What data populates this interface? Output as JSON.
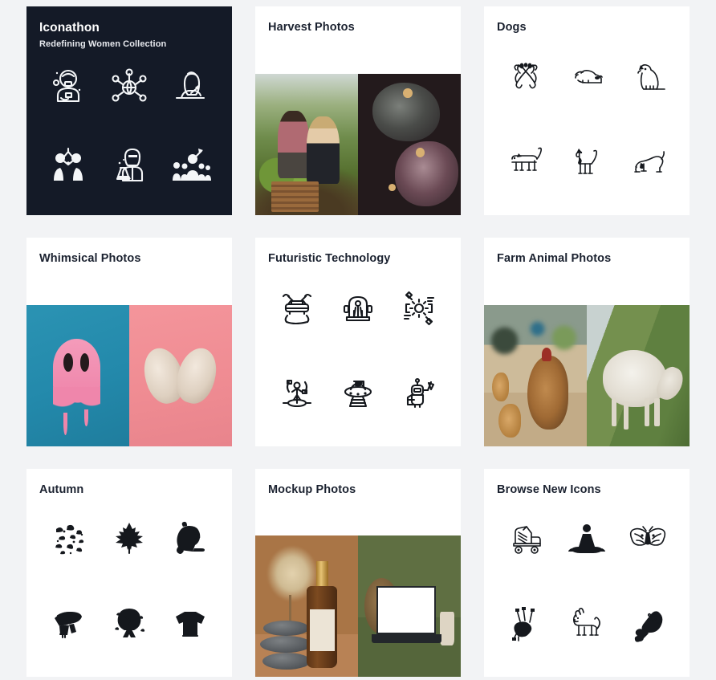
{
  "theme": {
    "page_background": "#f2f3f5",
    "card_background": "#ffffff",
    "dark_card_background": "#141a27",
    "title_color": "#1b2230",
    "icon_color": "#15181d",
    "whimsical_cyan": "#2389ab",
    "whimsical_pink": "#ef8b92",
    "mockup_tan": "#a97546",
    "mockup_green": "#5f6f42"
  },
  "cards": [
    {
      "id": "iconathon",
      "title": "Iconathon",
      "subtitle": "Redefining Women Collection",
      "kind": "icons",
      "dark": true,
      "icons": [
        "astronaut-woman-icon",
        "global-network-icon",
        "woman-writing-icon",
        "high-five-icon",
        "woman-scientist-flask-icon",
        "woman-leader-crowd-icon"
      ]
    },
    {
      "id": "harvest-photos",
      "title": "Harvest Photos",
      "subtitle": "",
      "kind": "photos",
      "dark": false,
      "photos": [
        "garden-harvest-family-photo",
        "dark-figs-closeup-photo"
      ]
    },
    {
      "id": "dogs",
      "title": "Dogs",
      "subtitle": "",
      "kind": "icons",
      "dark": false,
      "icons": [
        "dog-top-view-icon",
        "dog-lying-down-icon",
        "dog-sitting-icon",
        "dog-standing-icon",
        "dog-sitting-side-icon",
        "dog-play-bow-icon"
      ]
    },
    {
      "id": "whimsical-photos",
      "title": "Whimsical Photos",
      "subtitle": "",
      "kind": "photos",
      "dark": false,
      "photos": [
        "melting-pink-ghost-photo",
        "skull-heart-photo"
      ]
    },
    {
      "id": "futuristic-technology",
      "title": "Futuristic Technology",
      "subtitle": "",
      "kind": "icons",
      "dark": false,
      "icons": [
        "flying-car-icon",
        "teleportation-pod-icon",
        "ai-processing-icon",
        "hologram-projection-icon",
        "ufo-spaceship-icon",
        "cleaning-robot-icon"
      ]
    },
    {
      "id": "farm-animal-photos",
      "title": "Farm Animal Photos",
      "subtitle": "",
      "kind": "photos",
      "dark": false,
      "photos": [
        "chickens-yard-photo",
        "sheep-hillside-photo"
      ]
    },
    {
      "id": "autumn",
      "title": "Autumn",
      "subtitle": "",
      "kind": "icons",
      "dark": false,
      "icons": [
        "falling-leaves-icon",
        "maple-leaf-icon",
        "squirrel-icon",
        "scarf-icon",
        "autumn-tree-icon",
        "knitted-sweater-icon"
      ]
    },
    {
      "id": "mockup-photos",
      "title": "Mockup Photos",
      "subtitle": "",
      "kind": "photos",
      "dark": false,
      "photos": [
        "bottle-mockup-photo",
        "laptop-mockup-photo"
      ]
    },
    {
      "id": "browse-new-icons",
      "title": "Browse New Icons",
      "subtitle": "",
      "kind": "icons",
      "dark": false,
      "icons": [
        "roller-skate-icon",
        "yoga-lotus-pose-icon",
        "moth-icon",
        "bagpipes-icon",
        "shiba-dog-icon",
        "chicken-drumstick-icon"
      ]
    }
  ]
}
